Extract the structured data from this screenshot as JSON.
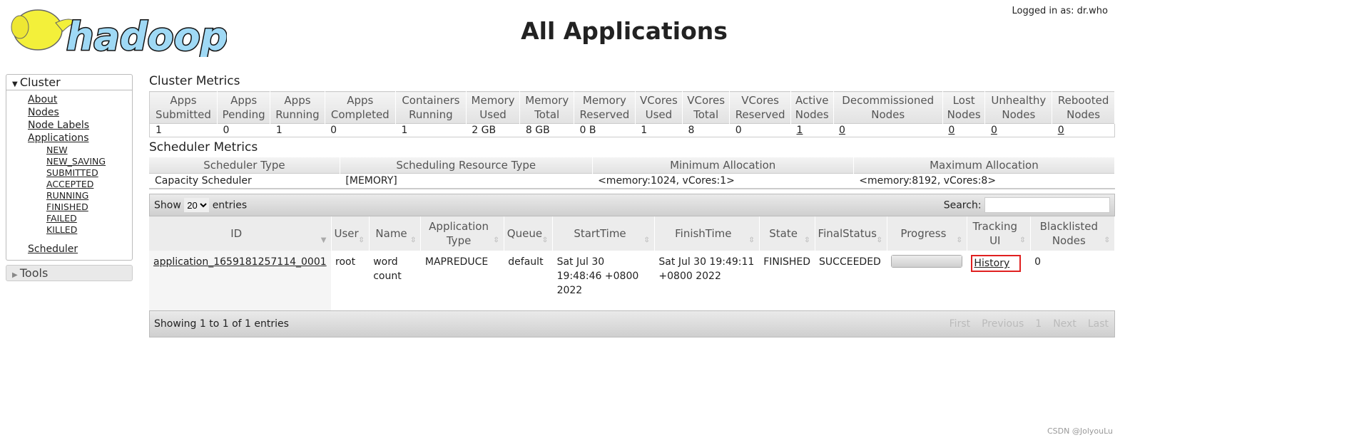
{
  "header": {
    "logo_text": "hadoop",
    "title": "All Applications",
    "login": "Logged in as: dr.who"
  },
  "nav": {
    "cluster": "Cluster",
    "items": [
      "About",
      "Nodes",
      "Node Labels",
      "Applications"
    ],
    "states": [
      "NEW",
      "NEW_SAVING",
      "SUBMITTED",
      "ACCEPTED",
      "RUNNING",
      "FINISHED",
      "FAILED",
      "KILLED"
    ],
    "scheduler": "Scheduler",
    "tools": "Tools"
  },
  "cluster_metrics": {
    "title": "Cluster Metrics",
    "headers": [
      [
        "Apps",
        "Submitted"
      ],
      [
        "Apps",
        "Pending"
      ],
      [
        "Apps",
        "Running"
      ],
      [
        "Apps",
        "Completed"
      ],
      [
        "Containers",
        "Running"
      ],
      [
        "Memory",
        "Used"
      ],
      [
        "Memory",
        "Total"
      ],
      [
        "Memory",
        "Reserved"
      ],
      [
        "VCores",
        "Used"
      ],
      [
        "VCores",
        "Total"
      ],
      [
        "VCores",
        "Reserved"
      ],
      [
        "Active",
        "Nodes"
      ],
      [
        "Decommissioned",
        "Nodes"
      ],
      [
        "Lost",
        "Nodes"
      ],
      [
        "Unhealthy",
        "Nodes"
      ],
      [
        "Rebooted",
        "Nodes"
      ]
    ],
    "values": [
      "1",
      "0",
      "1",
      "0",
      "1",
      "2 GB",
      "8 GB",
      "0 B",
      "1",
      "8",
      "0",
      "1",
      "0",
      "0",
      "0",
      "0"
    ]
  },
  "scheduler_metrics": {
    "title": "Scheduler Metrics",
    "headers": [
      "Scheduler Type",
      "Scheduling Resource Type",
      "Minimum Allocation",
      "Maximum Allocation"
    ],
    "values": [
      "Capacity Scheduler",
      "[MEMORY]",
      "<memory:1024, vCores:1>",
      "<memory:8192, vCores:8>"
    ]
  },
  "apps": {
    "show": "Show",
    "entries_value": "20",
    "entries": "entries",
    "search": "Search:",
    "search_value": "",
    "headers": [
      "ID",
      "User",
      "Name",
      "Application Type",
      "Queue",
      "StartTime",
      "FinishTime",
      "State",
      "FinalStatus",
      "Progress",
      "Tracking UI",
      "Blacklisted Nodes"
    ],
    "rows": [
      {
        "id": "application_1659181257114_0001",
        "user": "root",
        "name": "word count",
        "type": "MAPREDUCE",
        "queue": "default",
        "start": "Sat Jul 30 19:48:46 +0800 2022",
        "finish": "Sat Jul 30 19:49:11 +0800 2022",
        "state": "FINISHED",
        "final": "SUCCEEDED",
        "progress_percent": 100,
        "tracking": "History",
        "blacklisted": "0"
      }
    ],
    "info": "Showing 1 to 1 of 1 entries",
    "pager": [
      "First",
      "Previous",
      "1",
      "Next",
      "Last"
    ]
  },
  "watermark": "CSDN @JolyouLu"
}
